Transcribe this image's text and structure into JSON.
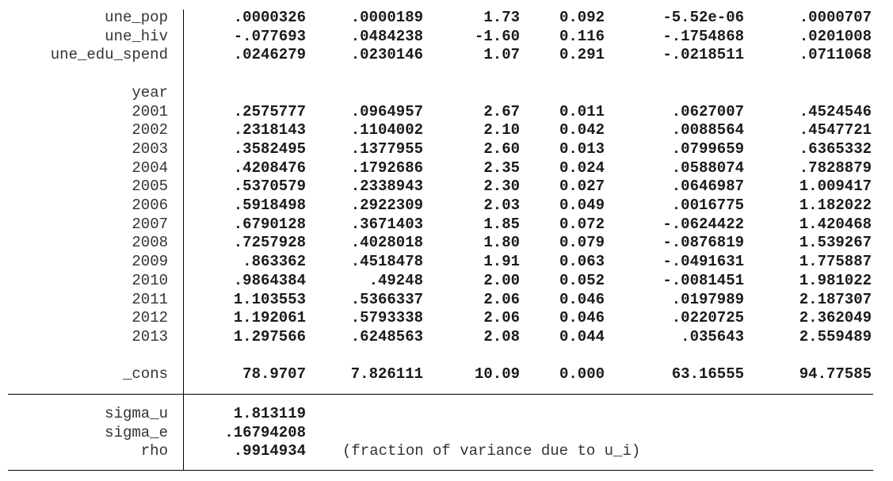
{
  "rows_top": [
    {
      "label": "une_pop",
      "vals": [
        ".0000326",
        ".0000189",
        "1.73",
        "0.092",
        "-5.52e-06",
        ".0000707"
      ]
    },
    {
      "label": "une_hiv",
      "vals": [
        "-.077693",
        ".0484238",
        "-1.60",
        "0.116",
        "-.1754868",
        ".0201008"
      ]
    },
    {
      "label": "une_edu_spend",
      "vals": [
        ".0246279",
        ".0230146",
        "1.07",
        "0.291",
        "-.0218511",
        ".0711068"
      ]
    }
  ],
  "year_header": "year",
  "rows_year": [
    {
      "label": "2001",
      "vals": [
        ".2575777",
        ".0964957",
        "2.67",
        "0.011",
        ".0627007",
        ".4524546"
      ]
    },
    {
      "label": "2002",
      "vals": [
        ".2318143",
        ".1104002",
        "2.10",
        "0.042",
        ".0088564",
        ".4547721"
      ]
    },
    {
      "label": "2003",
      "vals": [
        ".3582495",
        ".1377955",
        "2.60",
        "0.013",
        ".0799659",
        ".6365332"
      ]
    },
    {
      "label": "2004",
      "vals": [
        ".4208476",
        ".1792686",
        "2.35",
        "0.024",
        ".0588074",
        ".7828879"
      ]
    },
    {
      "label": "2005",
      "vals": [
        ".5370579",
        ".2338943",
        "2.30",
        "0.027",
        ".0646987",
        "1.009417"
      ]
    },
    {
      "label": "2006",
      "vals": [
        ".5918498",
        ".2922309",
        "2.03",
        "0.049",
        ".0016775",
        "1.182022"
      ]
    },
    {
      "label": "2007",
      "vals": [
        ".6790128",
        ".3671403",
        "1.85",
        "0.072",
        "-.0624422",
        "1.420468"
      ]
    },
    {
      "label": "2008",
      "vals": [
        ".7257928",
        ".4028018",
        "1.80",
        "0.079",
        "-.0876819",
        "1.539267"
      ]
    },
    {
      "label": "2009",
      "vals": [
        ".863362",
        ".4518478",
        "1.91",
        "0.063",
        "-.0491631",
        "1.775887"
      ]
    },
    {
      "label": "2010",
      "vals": [
        ".9864384",
        ".49248",
        "2.00",
        "0.052",
        "-.0081451",
        "1.981022"
      ]
    },
    {
      "label": "2011",
      "vals": [
        "1.103553",
        ".5366337",
        "2.06",
        "0.046",
        ".0197989",
        "2.187307"
      ]
    },
    {
      "label": "2012",
      "vals": [
        "1.192061",
        ".5793338",
        "2.06",
        "0.046",
        ".0220725",
        "2.362049"
      ]
    },
    {
      "label": "2013",
      "vals": [
        "1.297566",
        ".6248563",
        "2.08",
        "0.044",
        ".035643",
        "2.559489"
      ]
    }
  ],
  "cons": {
    "label": "_cons",
    "vals": [
      "78.9707",
      "7.826111",
      "10.09",
      "0.000",
      "63.16555",
      "94.77585"
    ]
  },
  "sigma": [
    {
      "label": "sigma_u",
      "val": "1.813119"
    },
    {
      "label": "sigma_e",
      "val": ".16794208"
    },
    {
      "label": "rho",
      "val": ".9914934"
    }
  ],
  "rho_note": "(fraction of variance due to u_i)"
}
